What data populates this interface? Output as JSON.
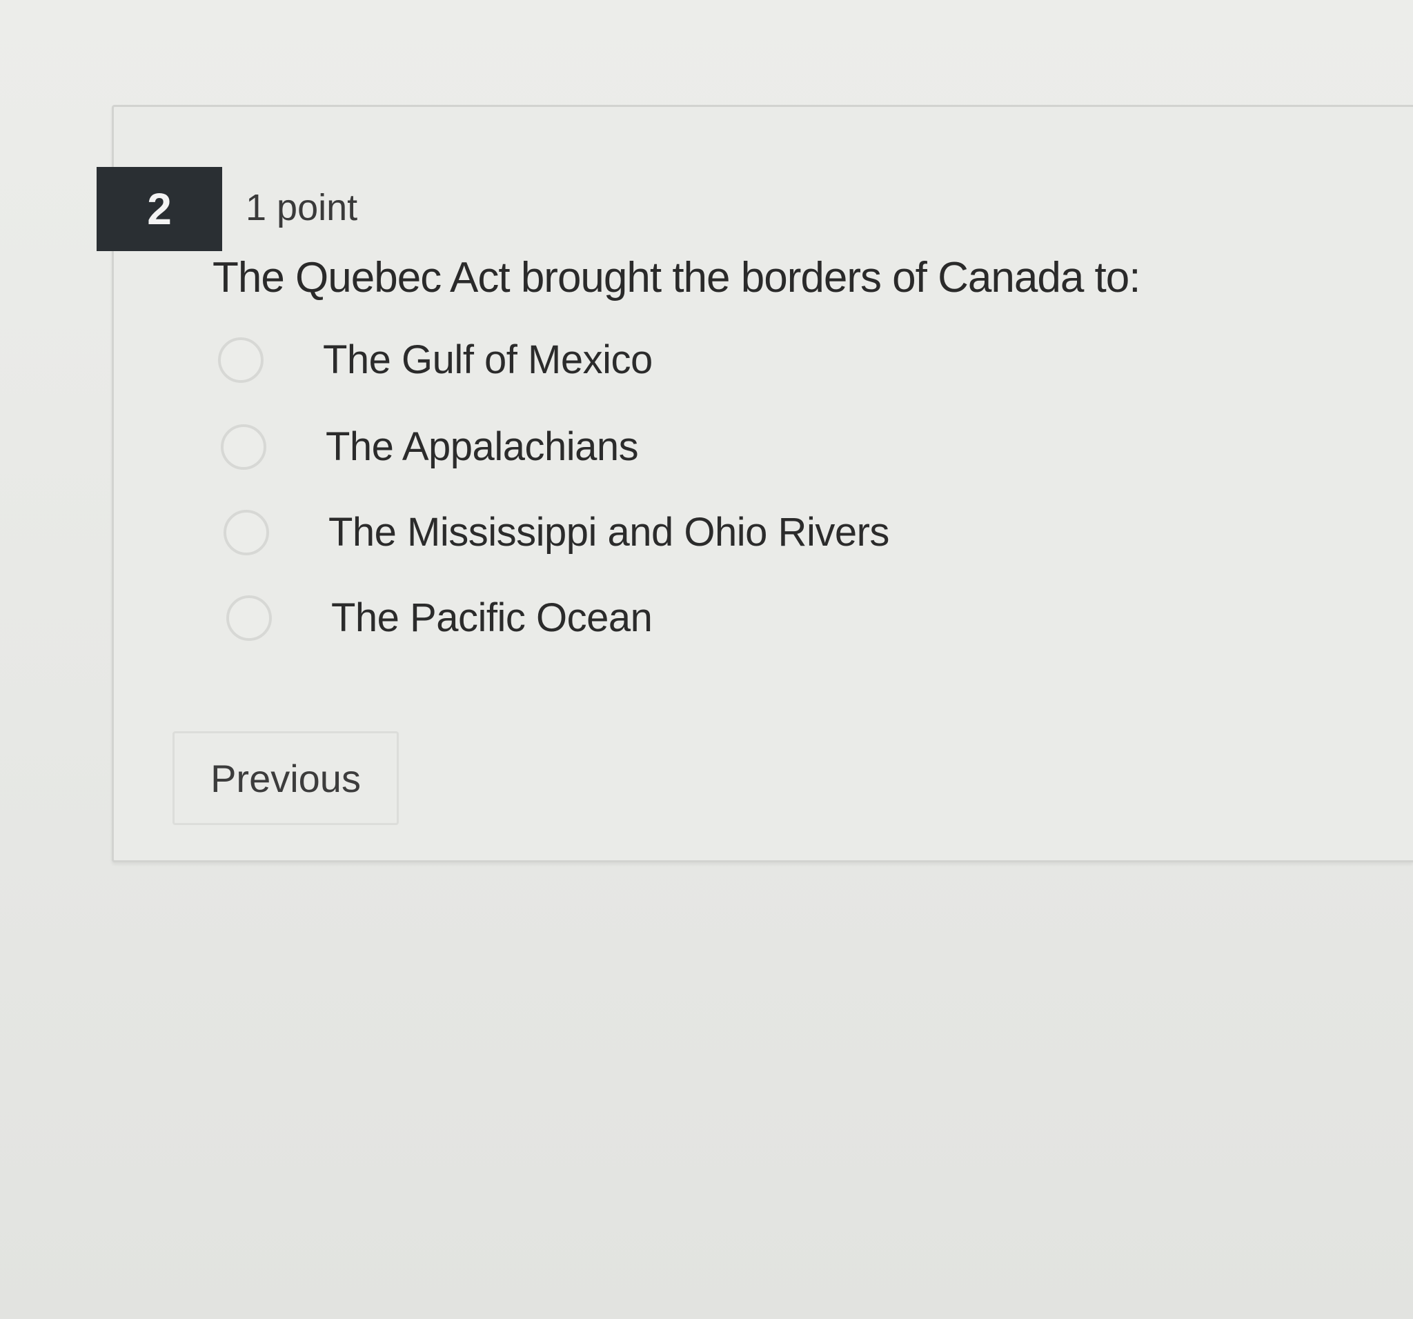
{
  "question": {
    "number": "2",
    "points": "1 point",
    "prompt": "The Quebec Act brought the borders of Canada to:",
    "options": [
      {
        "label": "The Gulf of Mexico",
        "selected": false
      },
      {
        "label": "The Appalachians",
        "selected": false
      },
      {
        "label": "The Mississippi and Ohio Rivers",
        "selected": false
      },
      {
        "label": "The Pacific Ocean",
        "selected": false
      }
    ]
  },
  "navigation": {
    "previous_label": "Previous"
  },
  "colors": {
    "number_badge_bg": "#2a2f33",
    "number_badge_text": "#f4f4f4",
    "page_bg": "#e9eae7",
    "radio_border": "#d7d8d5"
  }
}
